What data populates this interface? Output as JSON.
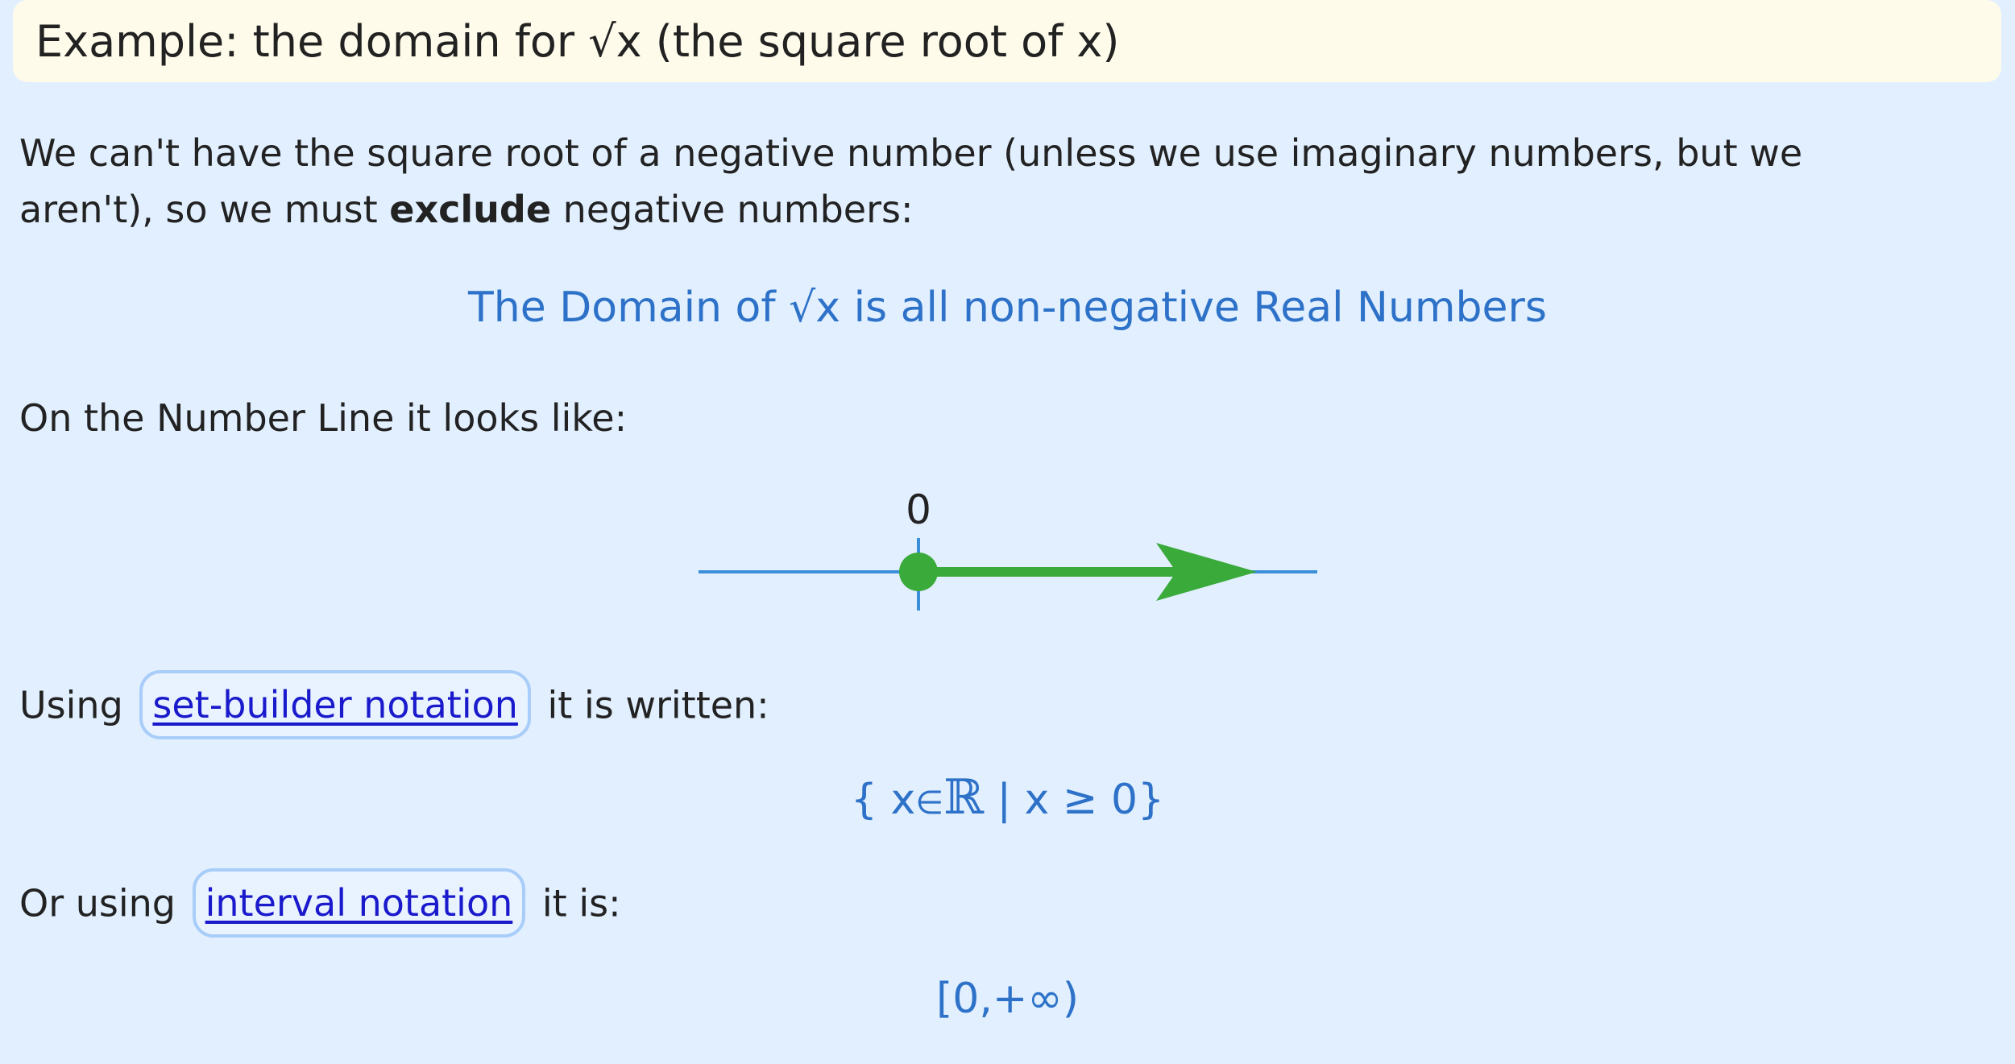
{
  "example": {
    "header": "Example: the domain for √x (the square root of x)"
  },
  "intro": {
    "line1": "We can't have the square root of a negative number (unless we use imaginary numbers, but we",
    "line2_pre": "aren't), so we must ",
    "line2_bold": "exclude",
    "line2_post": " negative numbers:"
  },
  "domain_statement": "The Domain of √x is all non-negative Real Numbers",
  "number_line": {
    "intro": "On the Number Line it looks like:",
    "tick_label": "0",
    "start_value": 0,
    "start_closed": true,
    "direction": "right",
    "colors": {
      "axis": "#3b8fd9",
      "ray": "#3aaa3a"
    }
  },
  "set_builder": {
    "pre": "Using",
    "link": "set-builder notation",
    "post": "it is written:",
    "expr_open": "{ x",
    "expr_elem": "∈",
    "expr_reals": "ℝ",
    "expr_rest": " | x ≥ 0}"
  },
  "interval": {
    "pre": "Or using",
    "link": "interval notation",
    "post": "it is:",
    "expr": "[0,+∞)"
  }
}
